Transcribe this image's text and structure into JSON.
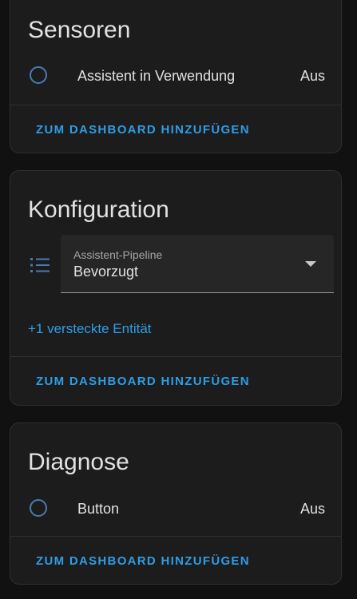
{
  "cards": {
    "sensoren": {
      "title": "Sensoren",
      "entity": {
        "label": "Assistent in Verwendung",
        "state": "Aus",
        "icon": "circle-outline-icon"
      },
      "action": "ZUM DASHBOARD HINZUFÜGEN"
    },
    "konfiguration": {
      "title": "Konfiguration",
      "select": {
        "label": "Assistent-Pipeline",
        "value": "Bevorzugt",
        "icon": "format-list-bulleted-icon"
      },
      "hidden_link": "+1 versteckte Entität",
      "action": "ZUM DASHBOARD HINZUFÜGEN"
    },
    "diagnose": {
      "title": "Diagnose",
      "entity": {
        "label": "Button",
        "state": "Aus",
        "icon": "circle-outline-icon"
      },
      "action": "ZUM DASHBOARD HINZUFÜGEN"
    }
  },
  "colors": {
    "accent": "#2f9de6",
    "icon": "#4a79b6",
    "card_background": "#1c1c1c",
    "page_background": "#111111"
  }
}
